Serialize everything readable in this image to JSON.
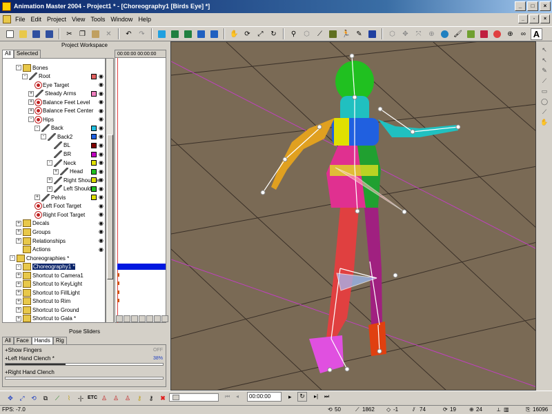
{
  "window": {
    "title": "Animation Master 2004 - Project1 * - [Choreography1 [Birds Eye] *]"
  },
  "menu": [
    "File",
    "Edit",
    "Project",
    "View",
    "Tools",
    "Window",
    "Help"
  ],
  "project_workspace": {
    "header": "Project Workspace",
    "tabs": [
      "All",
      "Selected"
    ],
    "timeline_time": "00:00:00",
    "timeline_time2": "00:00:00",
    "tree": [
      {
        "label": "Bones",
        "indent": 1,
        "exp": "-",
        "icon": "folder"
      },
      {
        "label": "Root",
        "indent": 2,
        "exp": "-",
        "icon": "bone",
        "color": "#e06060"
      },
      {
        "label": "Eye Target",
        "indent": 3,
        "exp": "",
        "icon": "null"
      },
      {
        "label": "Steady Arms",
        "indent": 3,
        "exp": "+",
        "icon": "bone",
        "color": "#f080c0"
      },
      {
        "label": "Balance Feet Level",
        "indent": 3,
        "exp": "+",
        "icon": "null"
      },
      {
        "label": "Balance Feet Center",
        "indent": 3,
        "exp": "+",
        "icon": "null"
      },
      {
        "label": "Hips",
        "indent": 3,
        "exp": "-",
        "icon": "null"
      },
      {
        "label": "Back",
        "indent": 4,
        "exp": "-",
        "icon": "bone",
        "color": "#20c0e0"
      },
      {
        "label": "Back2",
        "indent": 5,
        "exp": "-",
        "icon": "bone",
        "color": "#2060e0"
      },
      {
        "label": "BL",
        "indent": 6,
        "exp": "",
        "icon": "bone",
        "color": "#800000"
      },
      {
        "label": "BR",
        "indent": 6,
        "exp": "",
        "icon": "bone",
        "color": "#c000c0"
      },
      {
        "label": "Neck",
        "indent": 6,
        "exp": "-",
        "icon": "bone",
        "color": "#e0e000"
      },
      {
        "label": "Head",
        "indent": 7,
        "exp": "+",
        "icon": "bone",
        "color": "#20c020"
      },
      {
        "label": "Right Shoulder",
        "indent": 6,
        "exp": "+",
        "icon": "bone",
        "color": "#e0e000"
      },
      {
        "label": "Left Shoulder",
        "indent": 6,
        "exp": "+",
        "icon": "bone",
        "color": "#20c020"
      },
      {
        "label": "Pelvis",
        "indent": 4,
        "exp": "+",
        "icon": "bone",
        "color": "#e0e000"
      },
      {
        "label": "Left Foot Target",
        "indent": 3,
        "exp": "",
        "icon": "null"
      },
      {
        "label": "Right Foot Target",
        "indent": 3,
        "exp": "",
        "icon": "null"
      },
      {
        "label": "Decals",
        "indent": 1,
        "exp": "+",
        "icon": "folder"
      },
      {
        "label": "Groups",
        "indent": 1,
        "exp": "+",
        "icon": "folder"
      },
      {
        "label": "Relationships",
        "indent": 1,
        "exp": "+",
        "icon": "folder"
      },
      {
        "label": "Actions",
        "indent": 1,
        "exp": "",
        "icon": "folder"
      },
      {
        "label": "Choreographies *",
        "indent": 0,
        "exp": "-",
        "icon": "folder"
      },
      {
        "label": "Choreography1 *",
        "indent": 1,
        "exp": "-",
        "icon": "choreo",
        "selected": true
      },
      {
        "label": "Shortcut to Camera1",
        "indent": 1,
        "exp": "+",
        "icon": "camera"
      },
      {
        "label": "Shortcut to KeyLight",
        "indent": 1,
        "exp": "+",
        "icon": "light"
      },
      {
        "label": "Shortcut to FillLight",
        "indent": 1,
        "exp": "+",
        "icon": "light"
      },
      {
        "label": "Shortcut to Rim",
        "indent": 1,
        "exp": "+",
        "icon": "light"
      },
      {
        "label": "Shortcut to Ground",
        "indent": 1,
        "exp": "+",
        "icon": "ground"
      },
      {
        "label": "Shortcut to Gala *",
        "indent": 1,
        "exp": "+",
        "icon": "model"
      }
    ]
  },
  "pose_sliders": {
    "header": "Pose Sliders",
    "tabs": [
      "All",
      "Face",
      "Hands",
      "Rig"
    ],
    "rows": [
      {
        "label": "Show Fingers",
        "value": "OFF",
        "fill": 0
      },
      {
        "label": "Left Hand Clench *",
        "value": "38%",
        "fill": 0.38
      },
      {
        "label": "Right Hand Clench",
        "value": "",
        "fill": 0
      }
    ]
  },
  "transport": {
    "time": "00:00:00"
  },
  "status": {
    "fps": "FPS: -7.0",
    "v1": "50",
    "v2": "1862",
    "v3": "-1",
    "v4": "74",
    "v5": "19",
    "v6": "24",
    "v7": "16096"
  },
  "colors": {
    "bg": "#d4d0c8",
    "viewport": "#7a6a55",
    "grid": "#3a3028",
    "selection": "#0a246a"
  }
}
